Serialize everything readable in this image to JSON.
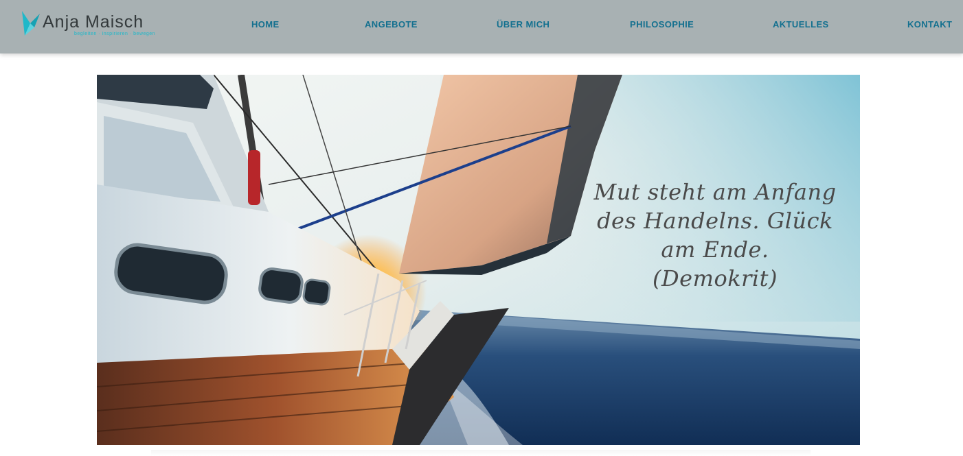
{
  "brand": {
    "name": "Anja Maisch",
    "tagline": "begleiten · inspirieren · bewegen",
    "accent_color": "#1fb8c9",
    "logo_icon": "origami-bird-icon"
  },
  "nav": {
    "items": [
      {
        "label": "HOME"
      },
      {
        "label": "ANGEBOTE"
      },
      {
        "label": "ÜBER MICH"
      },
      {
        "label": "PHILOSOPHIE"
      },
      {
        "label": "AKTUELLES"
      },
      {
        "label": "KONTAKT"
      }
    ],
    "text_color": "#13708f",
    "header_bg": "#a8b1b3"
  },
  "hero": {
    "image": "sailboat-at-sunset",
    "quote": "Mut steht am Anfang\ndes Handelns. Glück\nam Ende.\n(Demokrit)"
  }
}
